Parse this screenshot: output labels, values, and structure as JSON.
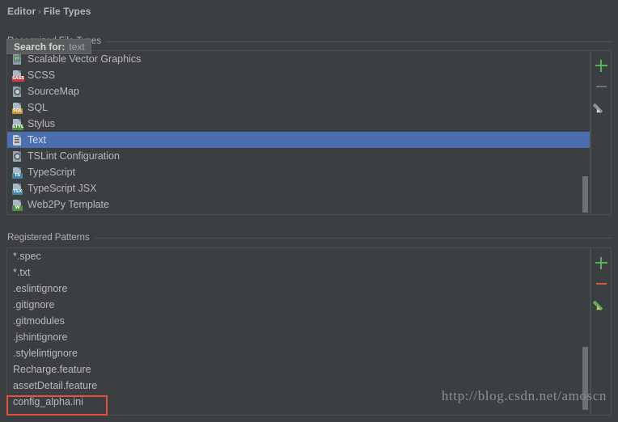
{
  "breadcrumb": {
    "root": "Editor",
    "separator": "›",
    "current": "File Types"
  },
  "recognized_section": {
    "label": "Recognized File Types"
  },
  "search_tooltip": {
    "label": "Search for:",
    "value": "text"
  },
  "file_types": {
    "items": [
      {
        "label": "Scalable Vector Graphics",
        "icon": "svg-image-file-icon",
        "icon_kind": "img",
        "badge": "",
        "badge_color": "",
        "selected": false
      },
      {
        "label": "SCSS",
        "icon": "sass-file-icon",
        "icon_kind": "badge",
        "badge": "SASS",
        "badge_color": "#c4413f",
        "selected": false
      },
      {
        "label": "SourceMap",
        "icon": "sourcemap-file-icon",
        "icon_kind": "gear",
        "badge": "",
        "badge_color": "",
        "selected": false
      },
      {
        "label": "SQL",
        "icon": "sql-file-icon",
        "icon_kind": "badge",
        "badge": "SQL",
        "badge_color": "#c9952f",
        "selected": false
      },
      {
        "label": "Stylus",
        "icon": "stylus-file-icon",
        "icon_kind": "badge",
        "badge": "STYL",
        "badge_color": "#4f9243",
        "selected": false
      },
      {
        "label": "Text",
        "icon": "text-file-icon",
        "icon_kind": "txt",
        "badge": "",
        "badge_color": "",
        "selected": true
      },
      {
        "label": "TSLint Configuration",
        "icon": "tslint-file-icon",
        "icon_kind": "gear",
        "badge": "",
        "badge_color": "",
        "selected": false
      },
      {
        "label": "TypeScript",
        "icon": "typescript-file-icon",
        "icon_kind": "badge",
        "badge": "TS",
        "badge_color": "#3d88a8",
        "selected": false
      },
      {
        "label": "TypeScript JSX",
        "icon": "typescript-jsx-file-icon",
        "icon_kind": "badge",
        "badge": "TSX",
        "badge_color": "#3d88a8",
        "selected": false
      },
      {
        "label": "Web2Py Template",
        "icon": "web2py-file-icon",
        "icon_kind": "badge",
        "badge": "W",
        "badge_color": "#4f9243",
        "selected": false
      }
    ]
  },
  "file_types_toolbar": {
    "add": {
      "name": "add-file-type-button",
      "glyph": "+",
      "color": "#5fad5f",
      "enabled": true
    },
    "remove": {
      "name": "remove-file-type-button",
      "glyph": "−",
      "color": "#6e7274",
      "enabled": false
    },
    "edit": {
      "name": "edit-file-type-button",
      "glyph": "pencil",
      "color": "#8e9295",
      "enabled": false
    }
  },
  "patterns_section": {
    "label": "Registered Patterns"
  },
  "patterns": {
    "items": [
      {
        "label": "*.spec"
      },
      {
        "label": "*.txt"
      },
      {
        "label": ".eslintignore"
      },
      {
        "label": ".gitignore"
      },
      {
        "label": ".gitmodules"
      },
      {
        "label": ".jshintignore"
      },
      {
        "label": ".stylelintignore"
      },
      {
        "label": "Recharge.feature"
      },
      {
        "label": "assetDetail.feature"
      },
      {
        "label": "config_alpha.ini"
      }
    ],
    "highlighted": "config_alpha.ini"
  },
  "patterns_toolbar": {
    "add": {
      "name": "add-pattern-button",
      "glyph": "+",
      "color": "#5fad5f",
      "enabled": true
    },
    "remove": {
      "name": "remove-pattern-button",
      "glyph": "−",
      "color": "#cf5b3f",
      "enabled": true
    },
    "edit": {
      "name": "edit-pattern-button",
      "glyph": "pencil",
      "color": "#63b05a",
      "enabled": true
    }
  },
  "annotation": {
    "color": "#e8503a"
  },
  "watermark": {
    "text": "http://blog.csdn.net/amoscn"
  }
}
